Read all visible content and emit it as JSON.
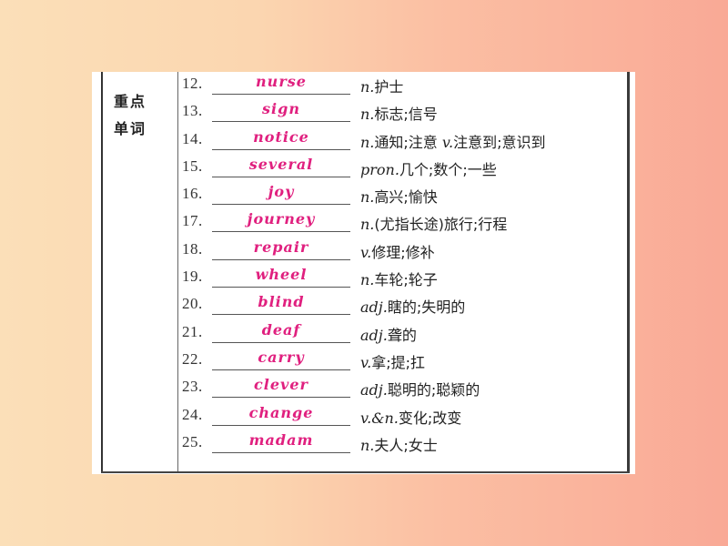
{
  "section": {
    "category_label_line1": "重点",
    "category_label_line2": "单词"
  },
  "colors": {
    "answer": "#e0207f",
    "background_start": "#fbdfb8",
    "background_end": "#f9a996"
  },
  "vocab": [
    {
      "num": "12.",
      "answer": "nurse",
      "pos": "n.",
      "meaning": "护士"
    },
    {
      "num": "13.",
      "answer": "sign",
      "pos": "n.",
      "meaning": "标志;信号"
    },
    {
      "num": "14.",
      "answer": "notice",
      "pos": "n.",
      "meaning": "通知;注意 ",
      "pos2": "v.",
      "meaning2": "注意到;意识到"
    },
    {
      "num": "15.",
      "answer": "several",
      "pos": "pron.",
      "meaning": "几个;数个;一些"
    },
    {
      "num": "16.",
      "answer": "joy",
      "pos": "n.",
      "meaning": "高兴;愉快"
    },
    {
      "num": "17.",
      "answer": "journey",
      "pos": "n.",
      "meaning": "(尤指长途)旅行;行程"
    },
    {
      "num": "18.",
      "answer": "repair",
      "pos": "v.",
      "meaning": "修理;修补"
    },
    {
      "num": "19.",
      "answer": "wheel",
      "pos": "n.",
      "meaning": "车轮;轮子"
    },
    {
      "num": "20.",
      "answer": "blind",
      "pos": "adj.",
      "meaning": "瞎的;失明的"
    },
    {
      "num": "21.",
      "answer": "deaf",
      "pos": "adj.",
      "meaning": "聋的"
    },
    {
      "num": "22.",
      "answer": "carry",
      "pos": "v.",
      "meaning": "拿;提;扛"
    },
    {
      "num": "23.",
      "answer": "clever",
      "pos": "adj.",
      "meaning": "聪明的;聪颖的"
    },
    {
      "num": "24.",
      "answer": "change",
      "pos": "v.&n.",
      "meaning": "变化;改变"
    },
    {
      "num": "25.",
      "answer": "madam",
      "pos": "n.",
      "meaning": "夫人;女士"
    }
  ]
}
